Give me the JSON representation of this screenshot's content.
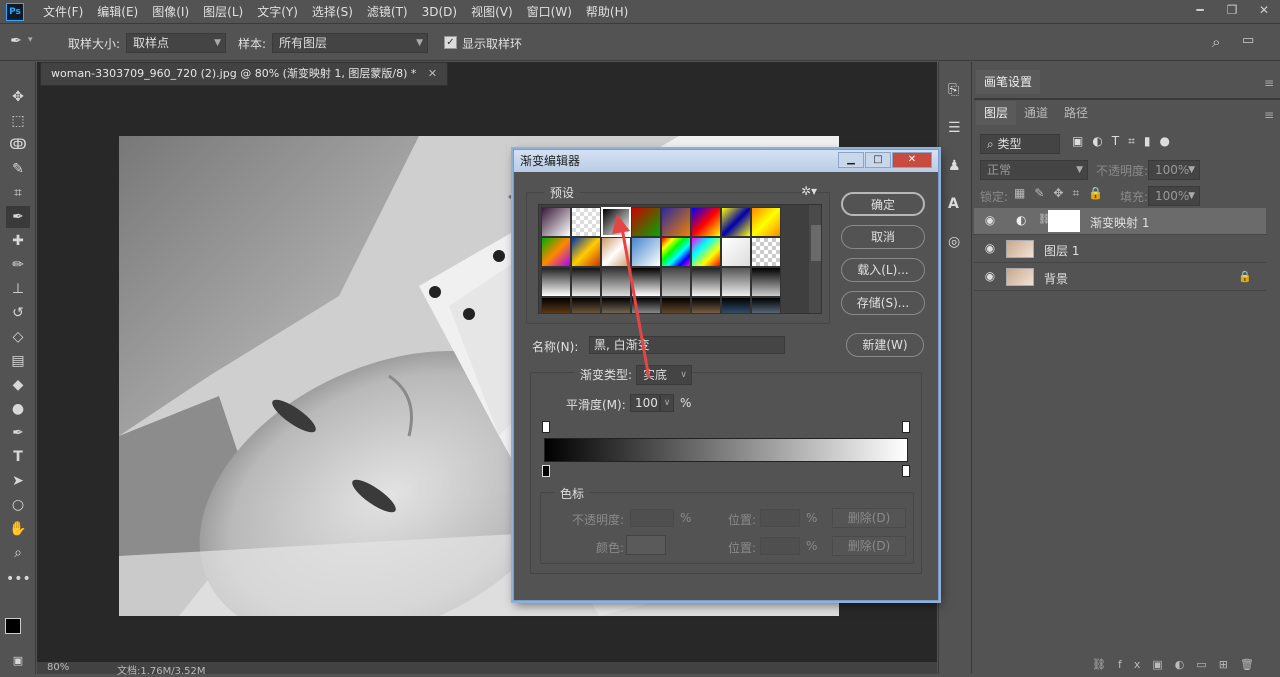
{
  "app": {
    "logo": "Ps"
  },
  "menu": [
    "文件(F)",
    "编辑(E)",
    "图像(I)",
    "图层(L)",
    "文字(Y)",
    "选择(S)",
    "滤镜(T)",
    "3D(D)",
    "视图(V)",
    "窗口(W)",
    "帮助(H)"
  ],
  "options": {
    "sample_size_label": "取样大小:",
    "sample_size_value": "取样点",
    "sample_label": "样本:",
    "sample_value": "所有图层",
    "show_ring_label": "显示取样环",
    "show_ring_checked": true
  },
  "document": {
    "tab_title": "woman-3303709_960_720 (2).jpg @ 80% (渐变映射 1, 图层蒙版/8) *",
    "zoom": "80%",
    "doc_info": "文档:1.76M/3.52M"
  },
  "dialog": {
    "title": "渐变编辑器",
    "presets_legend": "预设",
    "buttons": {
      "ok": "确定",
      "cancel": "取消",
      "load": "载入(L)...",
      "save": "存储(S)...",
      "new": "新建(W)"
    },
    "name_label": "名称(N):",
    "name_value": "黑, 白渐变",
    "gradient_type_label": "渐变类型:",
    "gradient_type_value": "实底",
    "smoothness_label": "平滑度(M):",
    "smoothness_value": "100",
    "percent": "%",
    "stops_legend": "色标",
    "opacity_label": "不透明度:",
    "position_label": "位置:",
    "color_label": "颜色:",
    "delete_label": "删除(D)",
    "gradient_colors": [
      "#000000",
      "#ffffff"
    ]
  },
  "panels": {
    "brush_settings_tab": "画笔设置",
    "tabs": [
      "图层",
      "通道",
      "路径"
    ],
    "filter_kind": "类型",
    "blend_mode": "正常",
    "opacity_label": "不透明度:",
    "opacity_value": "100%",
    "lock_label": "锁定:",
    "fill_label": "填充:",
    "fill_value": "100%",
    "layers": [
      {
        "name": "渐变映射 1",
        "selected": true
      },
      {
        "name": "图层 1",
        "selected": false
      },
      {
        "name": "背景",
        "selected": false,
        "locked": true
      }
    ]
  },
  "colors": {
    "accent": "#31a8ff",
    "annotation_arrow": "#e64545"
  }
}
